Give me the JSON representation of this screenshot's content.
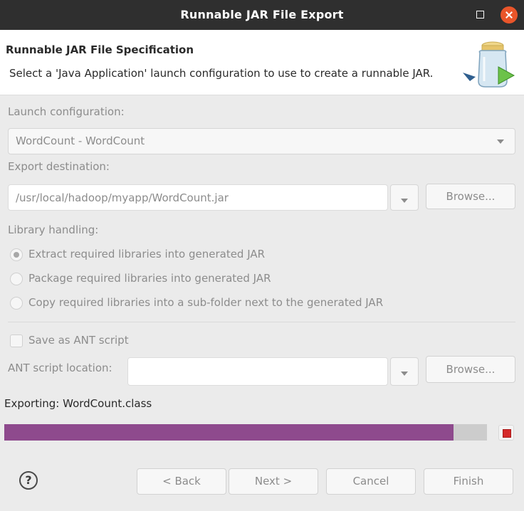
{
  "window": {
    "title": "Runnable JAR File Export",
    "maximize_icon": "maximize-icon",
    "close_icon": "close-icon"
  },
  "banner": {
    "heading": "Runnable JAR File Specification",
    "description": "Select a 'Java Application' launch configuration to use to create a runnable JAR.",
    "icon": "jar-file-icon"
  },
  "launch": {
    "label": "Launch configuration:",
    "value": "WordCount - WordCount"
  },
  "export": {
    "label": "Export destination:",
    "value": "/usr/local/hadoop/myapp/WordCount.jar",
    "browse_label": "Browse..."
  },
  "library": {
    "label": "Library handling:",
    "options": [
      {
        "label": "Extract required libraries into generated JAR",
        "checked": true
      },
      {
        "label": "Package required libraries into generated JAR",
        "checked": false
      },
      {
        "label": "Copy required libraries into a sub-folder next to the generated JAR",
        "checked": false
      }
    ]
  },
  "ant": {
    "save_label": "Save as ANT script",
    "save_checked": false,
    "location_label": "ANT script location:",
    "location_value": "",
    "browse_label": "Browse..."
  },
  "progress": {
    "status": "Exporting: WordCount.class",
    "fraction": 0.93,
    "fill_color": "#8e4a8d",
    "stop_icon": "stop-icon"
  },
  "footer": {
    "help_icon": "help-icon",
    "help_glyph": "?",
    "back_label": "< Back",
    "next_label": "Next >",
    "cancel_label": "Cancel",
    "finish_label": "Finish"
  }
}
